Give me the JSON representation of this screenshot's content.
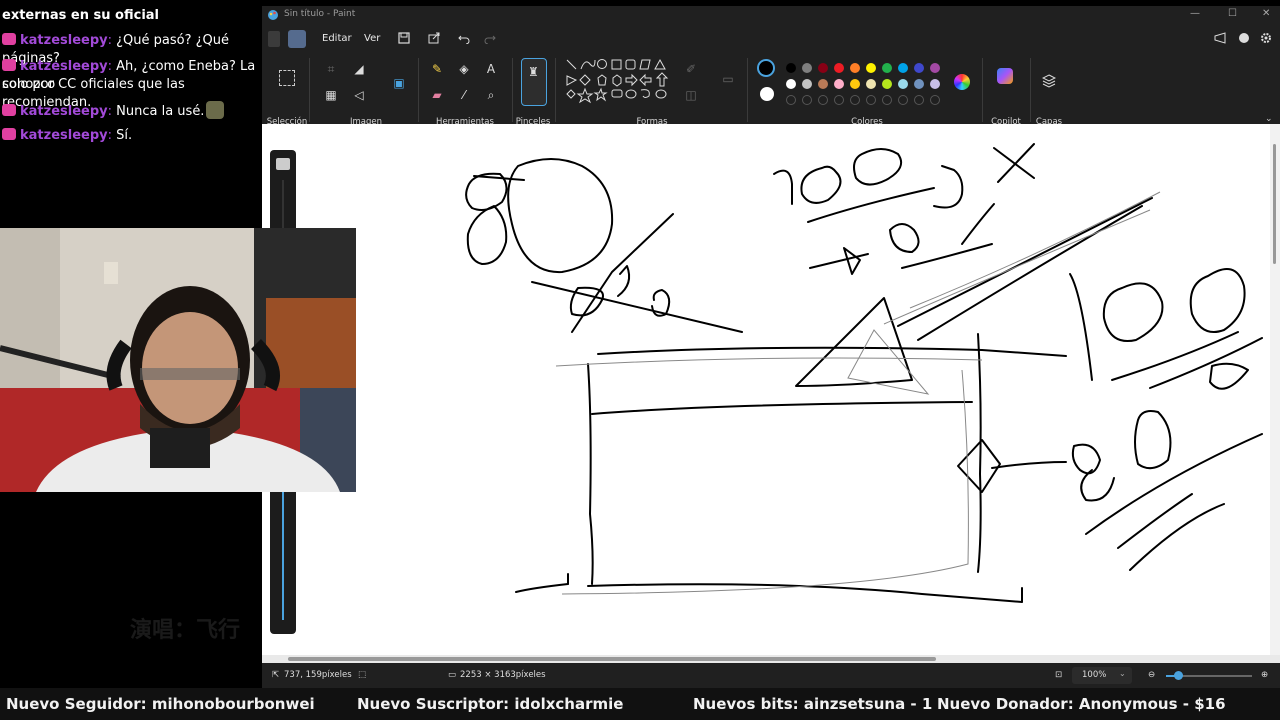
{
  "chat": {
    "partial_top": "externas en su oficial",
    "messages": [
      {
        "user": "katzesleepy",
        "text": "¿Qué pasó? ¿Qué páginas?"
      },
      {
        "user": "katzesleepy",
        "text": "Ah, ¿como Eneba? La conozco",
        "wrap": "solo por CC oficiales que las recomiendan."
      },
      {
        "user": "katzesleepy",
        "text": "Nunca la usé."
      },
      {
        "user": "katzesleepy",
        "text": "Sí."
      }
    ]
  },
  "overlay_watermark": "演唱：飞行",
  "paint": {
    "title": "Sin título - Paint",
    "menu": [
      "Editar",
      "Ver"
    ],
    "ribbon_groups": [
      "Selección",
      "Imagen",
      "Herramientas",
      "Pinceles",
      "Formas",
      "Colores",
      "Copilot",
      "Capas"
    ],
    "selected_color": "#000000",
    "palette_row1": [
      "#000000",
      "#7f7f7f",
      "#880015",
      "#ed1c24",
      "#ff7f27",
      "#fff200",
      "#22b14c",
      "#00a2e8",
      "#3f48cc",
      "#a349a4"
    ],
    "palette_row2": [
      "#ffffff",
      "#c3c3c3",
      "#b97a57",
      "#ffaec9",
      "#ffc90e",
      "#efe4b0",
      "#b5e61d",
      "#99d9ea",
      "#7092be",
      "#c8bfe7"
    ],
    "status": {
      "cursor_pos": "737, 159píxeles",
      "canvas_size": "2253 × 3163píxeles",
      "zoom": "100%"
    }
  },
  "ticker": {
    "follower": "Nuevo Seguidor: mihonobourbonwei",
    "subscriber": "Nuevo Suscriptor: idolxcharmie",
    "bits": "Nuevos bits: ainzsetsuna - 1",
    "donor": "Nuevo Donador: Anonymous - $16"
  }
}
